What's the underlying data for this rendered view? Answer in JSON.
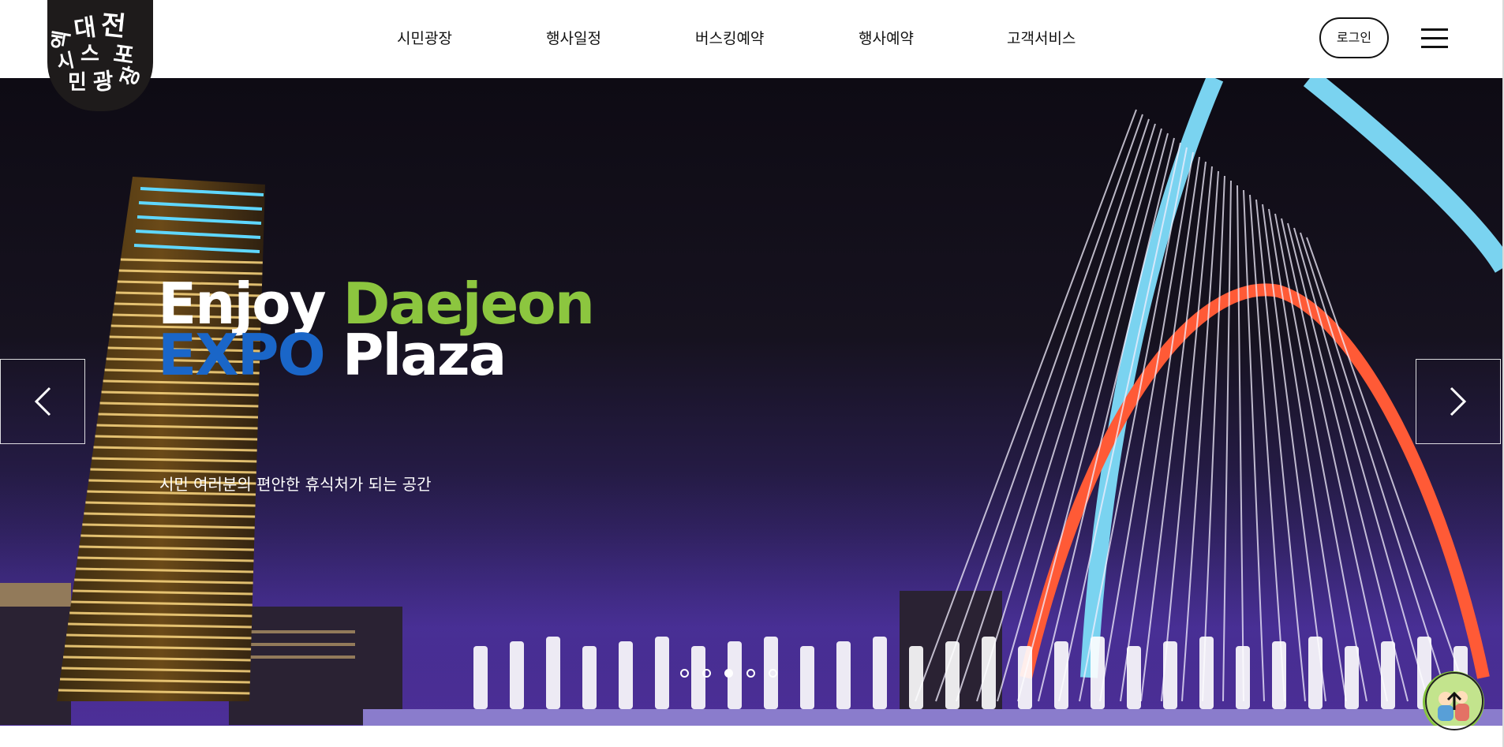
{
  "brand": {
    "logo_text": "엑스포 시민광장 대전",
    "logo_glyphs": [
      "대",
      "전",
      "엑",
      "스",
      "포",
      "시",
      "민",
      "광",
      "장"
    ]
  },
  "nav": {
    "items": [
      "시민광장",
      "행사일정",
      "버스킹예약",
      "행사예약",
      "고객서비스"
    ]
  },
  "header": {
    "login_label": "로그인",
    "menu_icon": "hamburger-menu-icon"
  },
  "hero": {
    "headline_line1_a": "Enjoy",
    "headline_line1_b": "Daejeon",
    "headline_line2_a": "EXPO",
    "headline_line2_b": "Plaza",
    "subtitle": "시민 여러분의 편안한 휴식처가 되는 공간",
    "prev_icon": "chevron-left-icon",
    "next_icon": "chevron-right-icon",
    "slide_count": 5,
    "active_slide": 3,
    "colors": {
      "white": "#ffffff",
      "green": "#8cc63f",
      "blue": "#1a66c8"
    }
  },
  "floating": {
    "mascot_icon": "mascot-character-icon",
    "top_button_icon": "arrow-up-icon"
  }
}
